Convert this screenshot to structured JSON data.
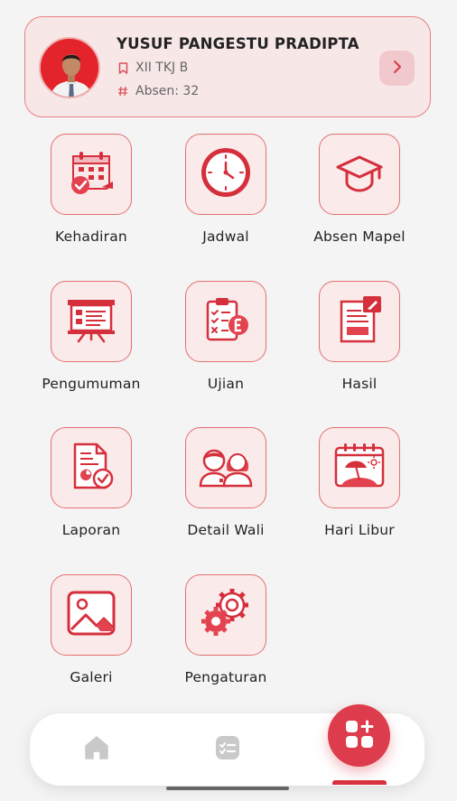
{
  "profile": {
    "name": "YUSUF PANGESTU PRADIPTA",
    "class": "XII TKJ B",
    "absen": "Absen: 32",
    "class_icon": "bookmark-icon",
    "absen_icon": "hash-icon",
    "accent": "#e3242b"
  },
  "menu": [
    {
      "label": "Kehadiran",
      "icon": "calendar-check-icon"
    },
    {
      "label": "Jadwal",
      "icon": "clock-icon"
    },
    {
      "label": "Absen Mapel",
      "icon": "graduation-cap-icon"
    },
    {
      "label": "Pengumuman",
      "icon": "presentation-board-icon"
    },
    {
      "label": "Ujian",
      "icon": "exam-clipboard-icon"
    },
    {
      "label": "Hasil",
      "icon": "document-edit-icon"
    },
    {
      "label": "Laporan",
      "icon": "report-chart-icon"
    },
    {
      "label": "Detail Wali",
      "icon": "parents-icon"
    },
    {
      "label": "Hari Libur",
      "icon": "holiday-calendar-icon"
    },
    {
      "label": "Galeri",
      "icon": "image-icon"
    },
    {
      "label": "Pengaturan",
      "icon": "settings-gears-icon"
    }
  ],
  "nav": {
    "items": [
      "home-icon",
      "task-list-icon",
      "apps-add-icon"
    ],
    "active": "apps-add-icon",
    "accent": "#dc3c4b"
  }
}
